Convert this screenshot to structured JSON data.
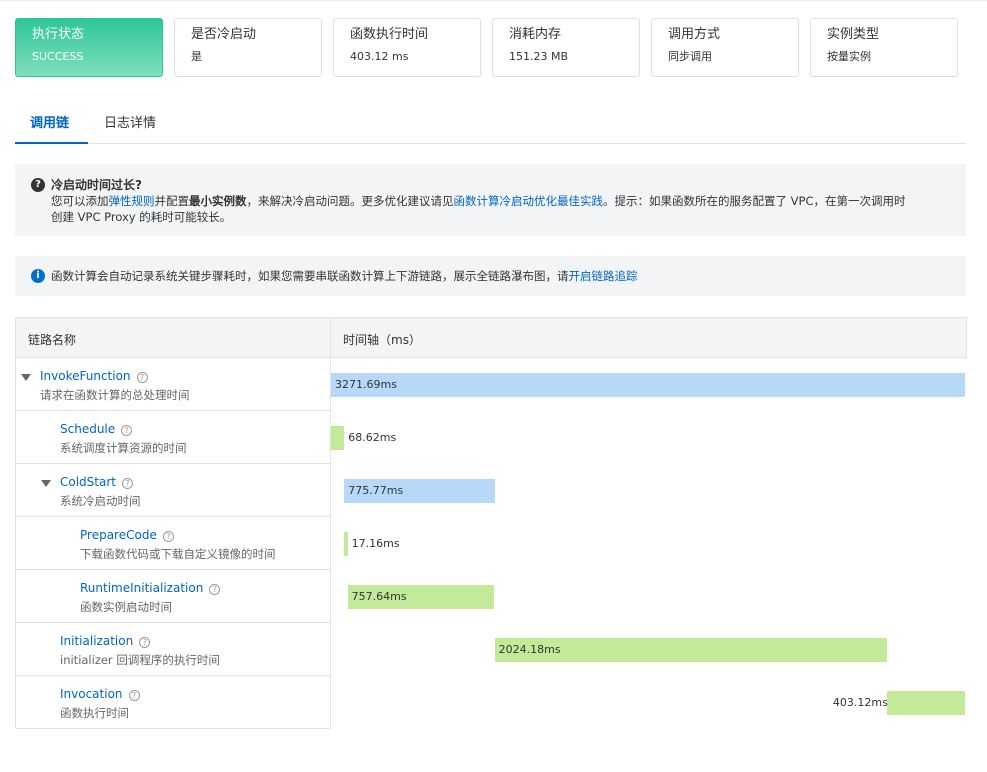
{
  "cards": [
    {
      "title": "执行状态",
      "value": "SUCCESS"
    },
    {
      "title": "是否冷启动",
      "value": "是"
    },
    {
      "title": "函数执行时间",
      "value": "403.12 ms"
    },
    {
      "title": "消耗内存",
      "value": "151.23 MB"
    },
    {
      "title": "调用方式",
      "value": "同步调用"
    },
    {
      "title": "实例类型",
      "value": "按量实例"
    }
  ],
  "tabs": [
    {
      "label": "调用链"
    },
    {
      "label": "日志详情"
    }
  ],
  "coldstart_notice": {
    "title": "冷启动时间过长?",
    "line1_a": "您可以添加",
    "line1_link1": "弹性规则",
    "line1_b": "并配置",
    "line1_bold": "最小实例数",
    "line1_c": "，来解决冷启动问题。更多优化建议请见",
    "line1_link2": "函数计算冷启动优化最佳实践",
    "line1_d": "。提示：如果函数所在的服务配置了 VPC，在第一次调用时",
    "line2": "创建 VPC Proxy 的耗时可能较长。"
  },
  "trace_notice": {
    "text": "函数计算会自动记录系统关键步骤耗时，如果您需要串联函数计算上下游链路，展示全链路瀑布图，请",
    "link": "开启链路追踪"
  },
  "table": {
    "col_name": "链路名称",
    "col_timeline": "时间轴（ms）",
    "rows": [
      {
        "name": "InvokeFunction",
        "desc": "请求在函数计算的总处理时间",
        "duration": "3271.69ms",
        "start_ms": 0,
        "duration_ms": 3271.69,
        "color": "#b8d8fa",
        "label_inside": true
      },
      {
        "name": "Schedule",
        "desc": "系统调度计算资源的时间",
        "duration": "68.62ms",
        "start_ms": 0,
        "duration_ms": 68.62,
        "color": "#c3ea99",
        "label_inside": false
      },
      {
        "name": "ColdStart",
        "desc": "系统冷启动时间",
        "duration": "775.77ms",
        "start_ms": 68.62,
        "duration_ms": 775.77,
        "color": "#b8d8fa",
        "label_inside": true
      },
      {
        "name": "PrepareCode",
        "desc": "下载函数代码或下载自定义镜像的时间",
        "duration": "17.16ms",
        "start_ms": 68.62,
        "duration_ms": 17.16,
        "color": "#c3ea99",
        "label_inside": false
      },
      {
        "name": "RuntimeInitialization",
        "desc": "函数实例启动时间",
        "duration": "757.64ms",
        "start_ms": 85.78,
        "duration_ms": 757.64,
        "color": "#c3ea99",
        "label_inside": true
      },
      {
        "name": "Initialization",
        "desc": "initializer 回调程序的执行时间",
        "duration": "2024.18ms",
        "start_ms": 844.39,
        "duration_ms": 2024.18,
        "color": "#c3ea99",
        "label_inside": true
      },
      {
        "name": "Invocation",
        "desc": "函数执行时间",
        "duration": "403.12ms",
        "start_ms": 2868.57,
        "duration_ms": 403.12,
        "color": "#c3ea99",
        "label_inside": false
      }
    ]
  },
  "total_ms": 3271.69
}
